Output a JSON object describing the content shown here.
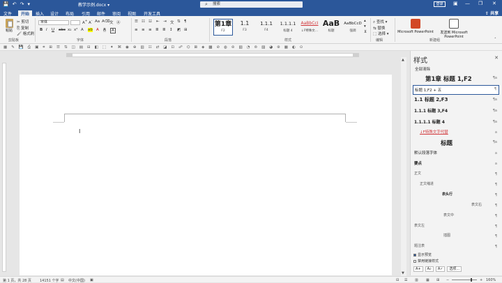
{
  "titlebar": {
    "doc_title": "教学示例.docx",
    "doc_title_suffix": "▾",
    "search_placeholder": "搜索",
    "login_label": "登录",
    "minimize": "—",
    "restore": "❐",
    "close": "✕"
  },
  "tabs": [
    {
      "label": "文件"
    },
    {
      "label": "开始"
    },
    {
      "label": "插入"
    },
    {
      "label": "设计"
    },
    {
      "label": "布局"
    },
    {
      "label": "引用"
    },
    {
      "label": "邮件"
    },
    {
      "label": "审阅"
    },
    {
      "label": "视图"
    },
    {
      "label": "开发工具"
    }
  ],
  "share_label": "共享",
  "ribbon": {
    "clipboard": {
      "paste": "粘贴",
      "cut": "剪切",
      "copy": "复制",
      "format_painter": "格式刷",
      "group": "剪贴板"
    },
    "font": {
      "name": "宋体",
      "size": "",
      "group": "字体"
    },
    "paragraph": {
      "group": "段落"
    },
    "styles": {
      "group": "样式",
      "items": [
        {
          "preview": "第1章",
          "name": "F2"
        },
        {
          "preview": "1.1",
          "name": "F3"
        },
        {
          "preview": "1.1.1",
          "name": "F4"
        },
        {
          "preview": "1.1.1.1",
          "name": "标题 4"
        },
        {
          "preview": "AaBbCcI",
          "name": "↓F特殊文..."
        },
        {
          "preview": "AaB",
          "name": "标题"
        },
        {
          "preview": "AaBbCcD",
          "name": "强调"
        }
      ]
    },
    "editing": {
      "find": "查找",
      "replace": "替换",
      "select": "选择",
      "group": "编辑"
    },
    "newgroup": {
      "item1": "Microsoft PowerPoint",
      "item2": "发送到 Microsoft PowerPoint",
      "group": "新建组"
    }
  },
  "pane": {
    "title": "样式",
    "clear_all": "全部清除",
    "items": [
      {
        "label": "第1章  标题 1,F2",
        "mark": "¶a"
      },
      {
        "label": "标题 1,F2 + 五",
        "mark": "¶"
      },
      {
        "label": "1.1  标题 2,F3",
        "mark": "¶a"
      },
      {
        "label": "1.1.1  标题 3,F4",
        "mark": "¶a"
      },
      {
        "label": "1.1.1.1  标题 4",
        "mark": "¶a"
      },
      {
        "label": "↓F特殊文字代替",
        "mark": "a"
      },
      {
        "label": "标题",
        "mark": "¶a"
      },
      {
        "label": "默认段落字体",
        "mark": "a"
      },
      {
        "label": "要点",
        "mark": "a"
      },
      {
        "label": "正文",
        "mark": "¶"
      },
      {
        "label": "正文缩进",
        "mark": "¶"
      },
      {
        "label": "表头行",
        "mark": "¶"
      },
      {
        "label": "表文右",
        "mark": "¶"
      },
      {
        "label": "表文中",
        "mark": "¶"
      },
      {
        "label": "表文左",
        "mark": "¶"
      },
      {
        "label": "插图",
        "mark": "¶"
      },
      {
        "label": "题注表",
        "mark": "¶"
      }
    ],
    "show_preview": "显示预览",
    "disable_linked": "禁用链接样式",
    "options": "选项..."
  },
  "status": {
    "page": "第 1 页，共 28 页",
    "words": "14151 个字",
    "language": "中文(中国)",
    "zoom": "160%"
  },
  "colors": {
    "accent": "#2b579a",
    "special_style_red": "#d13438"
  }
}
